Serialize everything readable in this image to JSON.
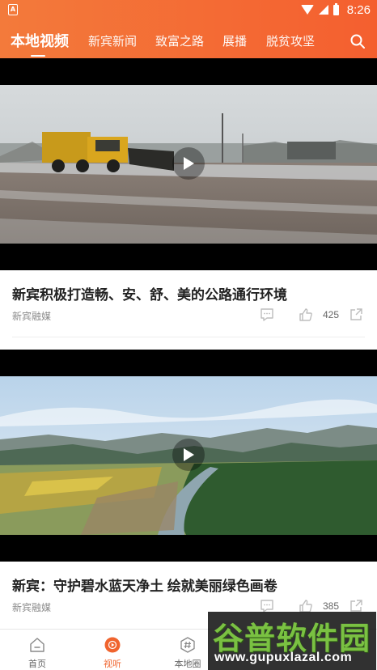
{
  "statusbar": {
    "app_glyph": "A",
    "time": "8:26"
  },
  "tabs": [
    {
      "label": "本地视频",
      "active": true
    },
    {
      "label": "新宾新闻"
    },
    {
      "label": "致富之路"
    },
    {
      "label": "展播"
    },
    {
      "label": "脱贫攻坚"
    }
  ],
  "icons": {
    "search": "search-icon",
    "play": "play-icon",
    "comment": "comment-icon",
    "like": "thumbs-up-icon",
    "share": "share-icon"
  },
  "feed": {
    "items": [
      {
        "title": "新宾积极打造畅、安、舒、美的公路通行环境",
        "source": "新宾融媒",
        "likes": "425"
      },
      {
        "title": "新宾：守护碧水蓝天净土  绘就美丽绿色画卷",
        "source": "新宾融媒",
        "likes": "385"
      }
    ]
  },
  "bottom_nav": [
    {
      "label": "首页",
      "icon": "home-icon"
    },
    {
      "label": "视听",
      "icon": "play-circle-icon",
      "active": true
    },
    {
      "label": "本地圈",
      "icon": "hashtag-icon"
    }
  ],
  "watermark": {
    "main": "谷普软件园",
    "url": "www.gupuxlazal.com"
  },
  "colors": {
    "accent": "#f0642e",
    "header_start": "#f37a3b",
    "header_end": "#f45f2f"
  }
}
